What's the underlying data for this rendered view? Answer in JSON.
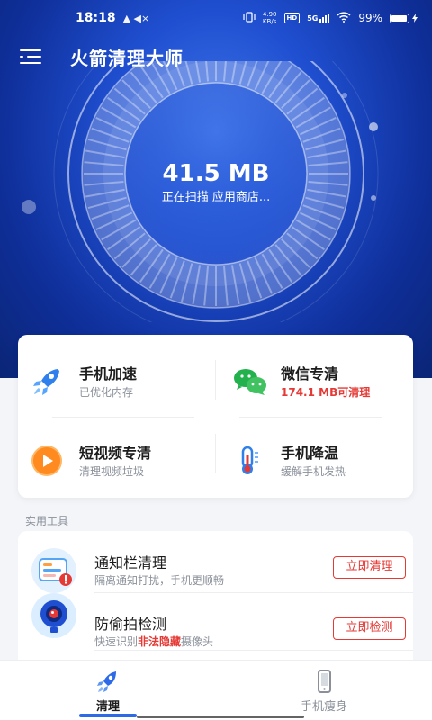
{
  "status_bar": {
    "time": "18:18",
    "notif_icons": "▲ ◀×",
    "net_speed_value": "4.90",
    "net_speed_unit": "KB/s",
    "hd_label": "HD",
    "signal_label": "5G",
    "battery_percent": "99%"
  },
  "header": {
    "title": "火箭清理大师"
  },
  "scan": {
    "size_value": "41.5 MB",
    "status_text": "正在扫描 应用商店..."
  },
  "features": [
    {
      "title": "手机加速",
      "subtitle": "已优化内存"
    },
    {
      "title": "微信专清",
      "subtitle": "174.1 MB可清理"
    },
    {
      "title": "短视频专清",
      "subtitle": "清理视频垃圾"
    },
    {
      "title": "手机降温",
      "subtitle": "缓解手机发热"
    }
  ],
  "section": {
    "tools_label": "实用工具"
  },
  "tools": [
    {
      "title": "通知栏清理",
      "desc": "隔离通知打扰，手机更顺畅",
      "action": "立即清理"
    },
    {
      "title": "防偷拍检测",
      "desc_pre": "快速识别",
      "desc_highlight": "非法隐藏",
      "desc_post": "摄像头",
      "action": "立即检测"
    }
  ],
  "bottom_nav": {
    "items": [
      {
        "label": "清理"
      },
      {
        "label": "手机瘦身"
      }
    ]
  },
  "colors": {
    "brand_blue": "#2c6ae8",
    "hero_dark": "#0a2576",
    "alert_red": "#e53935"
  }
}
